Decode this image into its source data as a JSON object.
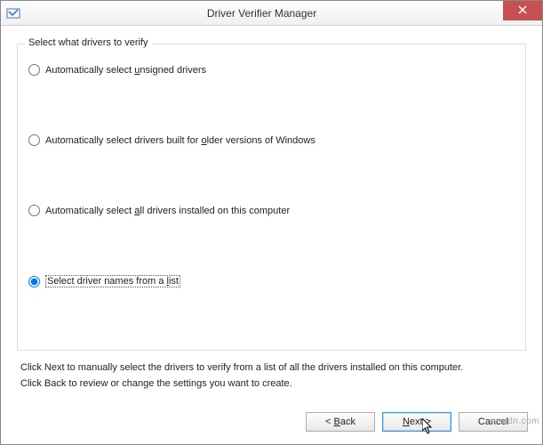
{
  "window": {
    "title": "Driver Verifier Manager"
  },
  "group": {
    "legend": "Select what drivers to verify"
  },
  "options": {
    "opt1_pre": "Automatically select ",
    "opt1_u": "u",
    "opt1_post": "nsigned drivers",
    "opt2_pre": "Automatically select drivers built for ",
    "opt2_u": "o",
    "opt2_post": "lder versions of Windows",
    "opt3_pre": "Automatically select ",
    "opt3_u": "a",
    "opt3_post": "ll drivers installed on this computer",
    "opt4_pre": "Select driver names from a ",
    "opt4_u": "l",
    "opt4_post": "ist",
    "selected": "opt4"
  },
  "help": {
    "line1": "Click Next to manually select the drivers to verify from a list of all the drivers installed on this computer.",
    "line2": "Click Back to review or change the settings you want to create."
  },
  "buttons": {
    "back_pre": "< ",
    "back_u": "B",
    "back_post": "ack",
    "next_pre": "",
    "next_u": "N",
    "next_post": "ext >",
    "cancel": "Cancel"
  },
  "watermark": "wsxdn.com"
}
